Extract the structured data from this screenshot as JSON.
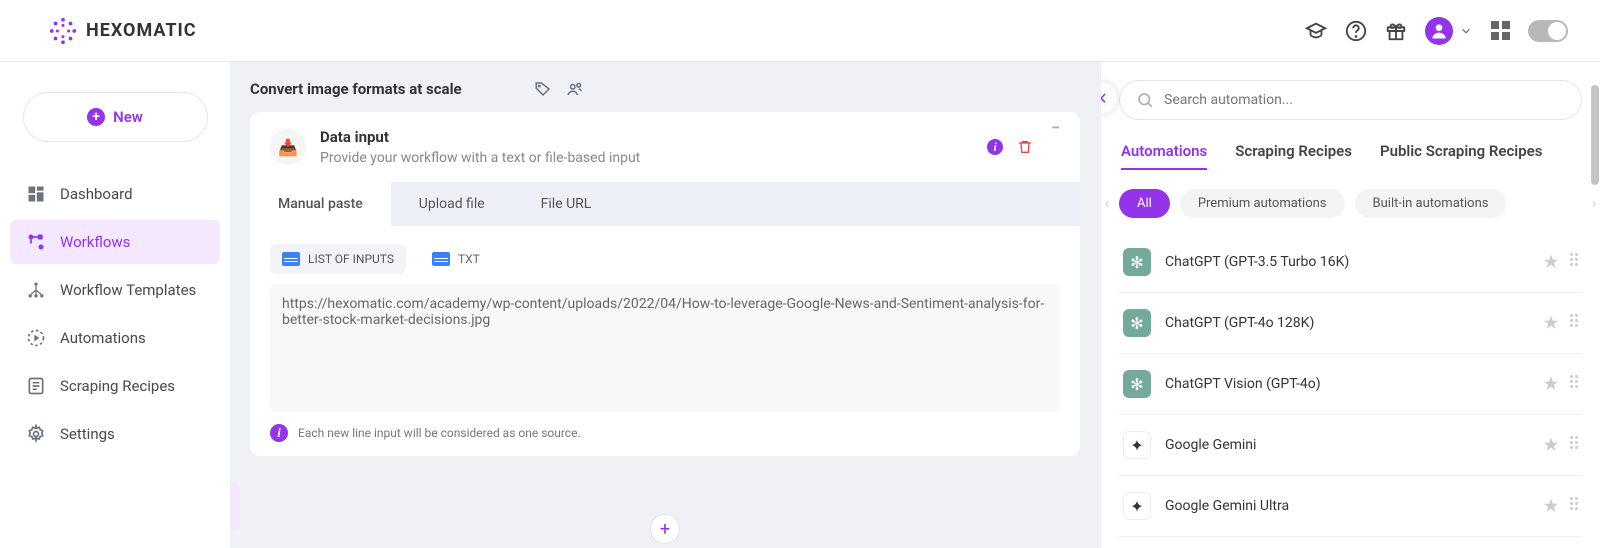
{
  "brand": "HEXOMATIC",
  "sidebar": {
    "new_label": "New",
    "items": [
      {
        "label": "Dashboard"
      },
      {
        "label": "Workflows"
      },
      {
        "label": "Workflow Templates"
      },
      {
        "label": "Automations"
      },
      {
        "label": "Scraping Recipes"
      },
      {
        "label": "Settings"
      }
    ]
  },
  "workflow": {
    "title": "Convert image formats at scale",
    "data_input": {
      "title": "Data input",
      "subtitle": "Provide your workflow with a text or file-based input",
      "tabs": [
        "Manual paste",
        "Upload file",
        "File URL"
      ],
      "input_types": {
        "list": "LIST OF INPUTS",
        "txt": "TXT"
      },
      "value": "https://hexomatic.com/academy/wp-content/uploads/2022/04/How-to-leverage-Google-News-and-Sentiment-analysis-for-better-stock-market-decisions.jpg",
      "hint": "Each new line input will be considered as one source."
    }
  },
  "panel": {
    "search_placeholder": "Search automation...",
    "tabs": [
      "Automations",
      "Scraping Recipes",
      "Public Scraping Recipes"
    ],
    "pills": [
      "All",
      "Premium automations",
      "Built-in automations"
    ],
    "items": [
      {
        "name": "ChatGPT (GPT-3.5 Turbo 16K)",
        "kind": "gpt"
      },
      {
        "name": "ChatGPT (GPT-4o 128K)",
        "kind": "gpt"
      },
      {
        "name": "ChatGPT Vision (GPT-4o)",
        "kind": "gpt"
      },
      {
        "name": "Google Gemini",
        "kind": "gem"
      },
      {
        "name": "Google Gemini Ultra",
        "kind": "gem"
      }
    ]
  }
}
